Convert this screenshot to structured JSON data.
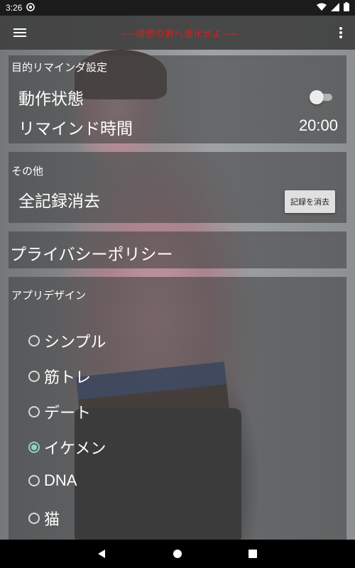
{
  "status_bar": {
    "time": "3:26",
    "icons": [
      "notification-icon",
      "wifi-icon",
      "signal-icon",
      "battery-icon"
    ]
  },
  "app_bar": {
    "title": "~~理想の男へ進化せよ~~",
    "title_color": "#e01b1b",
    "icons": [
      "hamburger-menu-icon",
      "overflow-menu-icon"
    ]
  },
  "reminder": {
    "section_label": "目的リマインダ設定",
    "status_label": "動作状態",
    "status_on": false,
    "time_label": "リマインド時間",
    "time_value": "20:00"
  },
  "other": {
    "section_label": "その他",
    "clear_label": "全記録消去",
    "clear_button": "記録を消去"
  },
  "privacy": {
    "label": "プライバシーポリシー"
  },
  "design": {
    "section_label": "アプリデザイン",
    "accent_color": "#8fd1c6",
    "options": [
      {
        "label": "シンプル",
        "checked": false
      },
      {
        "label": "筋トレ",
        "checked": false
      },
      {
        "label": "デート",
        "checked": false
      },
      {
        "label": "イケメン",
        "checked": true
      },
      {
        "label": "DNA",
        "checked": false
      },
      {
        "label": "猫",
        "checked": false
      }
    ]
  },
  "nav_bar": {
    "icons": [
      "back-icon",
      "home-icon",
      "recents-icon"
    ]
  }
}
